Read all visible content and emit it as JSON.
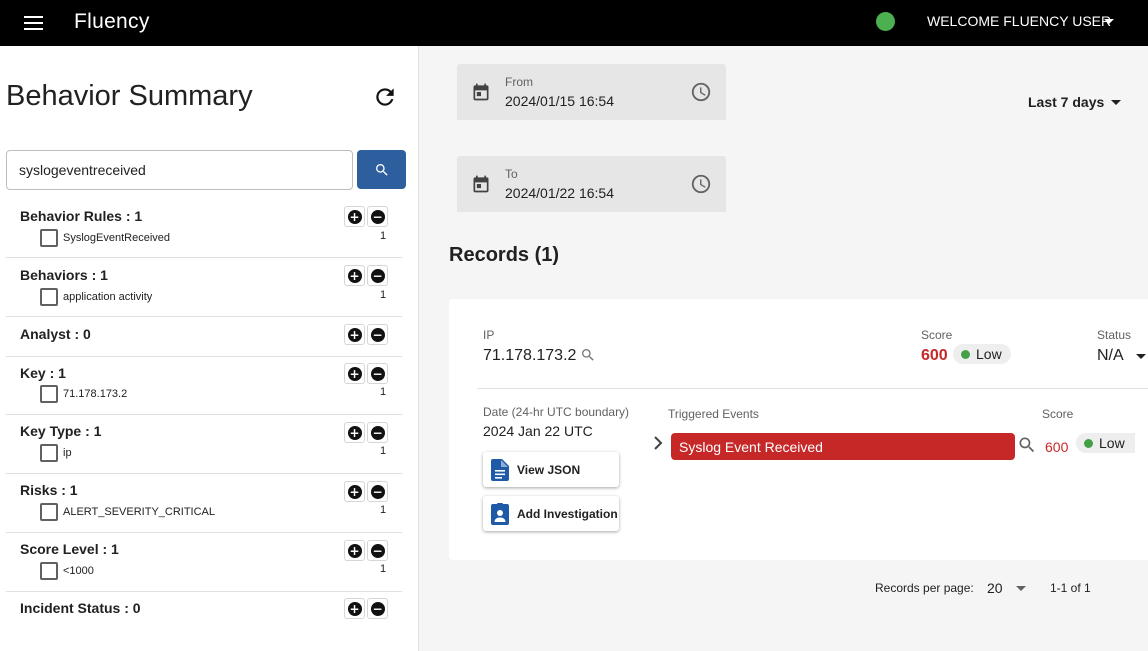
{
  "header": {
    "app_title": "Fluency",
    "welcome_text": "WELCOME FLUENCY USER",
    "status_color": "#4caf50"
  },
  "sidebar": {
    "title": "Behavior Summary",
    "search_value": "syslogeventreceived",
    "facets": [
      {
        "title": "Behavior Rules : 1",
        "items": [
          {
            "label": "SyslogEventReceived",
            "count": "1"
          }
        ]
      },
      {
        "title": "Behaviors : 1",
        "items": [
          {
            "label": "application activity",
            "count": "1"
          }
        ]
      },
      {
        "title": "Analyst : 0",
        "items": []
      },
      {
        "title": "Key : 1",
        "items": [
          {
            "label": "71.178.173.2",
            "count": "1"
          }
        ]
      },
      {
        "title": "Key Type : 1",
        "items": [
          {
            "label": "ip",
            "count": "1"
          }
        ]
      },
      {
        "title": "Risks : 1",
        "items": [
          {
            "label": "ALERT_SEVERITY_CRITICAL",
            "count": "1"
          }
        ]
      },
      {
        "title": "Score Level : 1",
        "items": [
          {
            "label": "<1000",
            "count": "1"
          }
        ]
      },
      {
        "title": "Incident Status : 0",
        "items": []
      }
    ]
  },
  "filters": {
    "from_label": "From",
    "from_value": "2024/01/15 16:54",
    "to_label": "To",
    "to_value": "2024/01/22 16:54",
    "range": "Last 7 days"
  },
  "records": {
    "title": "Records (1)",
    "record": {
      "ip_label": "IP",
      "ip_value": "71.178.173.2",
      "score_label": "Score",
      "score_value": "600",
      "level": "Low",
      "status_label": "Status",
      "status_value": "N/A",
      "date_label": "Date (24-hr UTC boundary)",
      "date_value": "2024 Jan 22 UTC",
      "view_json_label": "View JSON",
      "add_investigation_label": "Add Investigation",
      "triggered_label": "Triggered Events",
      "event_score_label": "Score",
      "event_name": "Syslog Event Received",
      "event_score": "600",
      "event_level": "Low"
    },
    "pagination": {
      "per_page_label": "Records per page:",
      "per_page_value": "20",
      "range_text": "1-1 of 1"
    }
  },
  "colors": {
    "accent_blue": "#2d5f9e",
    "critical_red": "#c62828",
    "low_green": "#43a047"
  }
}
